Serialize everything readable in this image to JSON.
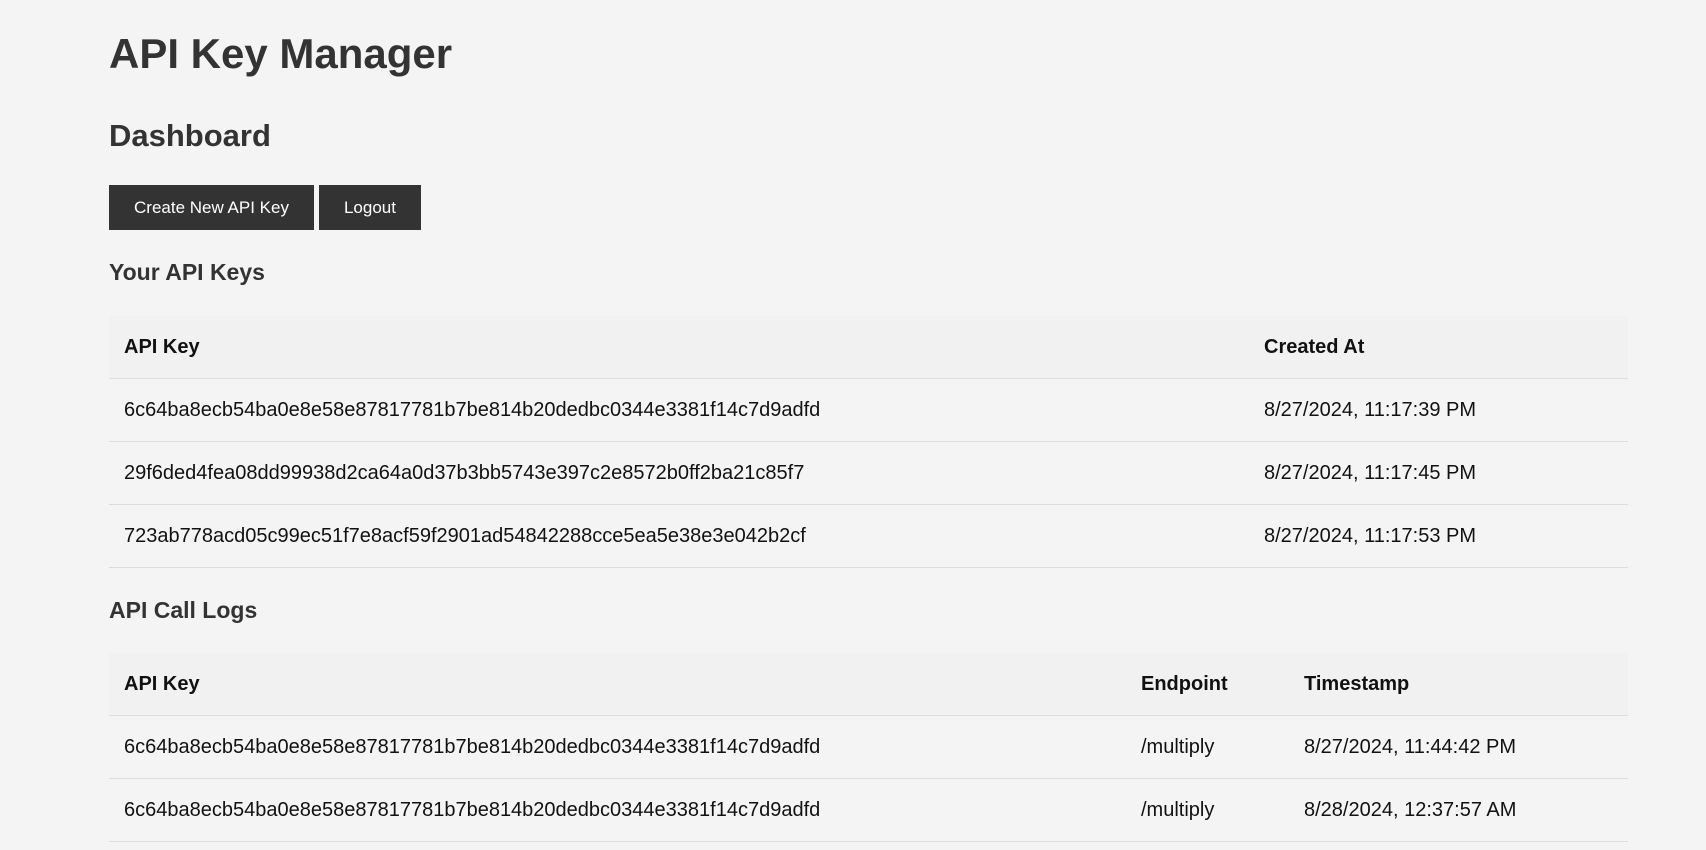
{
  "header": {
    "title": "API Key Manager",
    "subtitle": "Dashboard"
  },
  "actions": {
    "create_label": "Create New API Key",
    "logout_label": "Logout"
  },
  "api_keys": {
    "heading": "Your API Keys",
    "columns": [
      "API Key",
      "Created At"
    ],
    "rows": [
      {
        "key": "6c64ba8ecb54ba0e8e58e87817781b7be814b20dedbc0344e3381f14c7d9adfd",
        "created_at": "8/27/2024, 11:17:39 PM"
      },
      {
        "key": "29f6ded4fea08dd99938d2ca64a0d37b3bb5743e397c2e8572b0ff2ba21c85f7",
        "created_at": "8/27/2024, 11:17:45 PM"
      },
      {
        "key": "723ab778acd05c99ec51f7e8acf59f2901ad54842288cce5ea5e38e3e042b2cf",
        "created_at": "8/27/2024, 11:17:53 PM"
      }
    ]
  },
  "call_logs": {
    "heading": "API Call Logs",
    "columns": [
      "API Key",
      "Endpoint",
      "Timestamp"
    ],
    "rows": [
      {
        "key": "6c64ba8ecb54ba0e8e58e87817781b7be814b20dedbc0344e3381f14c7d9adfd",
        "endpoint": "/multiply",
        "timestamp": "8/27/2024, 11:44:42 PM"
      },
      {
        "key": "6c64ba8ecb54ba0e8e58e87817781b7be814b20dedbc0344e3381f14c7d9adfd",
        "endpoint": "/multiply",
        "timestamp": "8/28/2024, 12:37:57 AM"
      }
    ]
  }
}
